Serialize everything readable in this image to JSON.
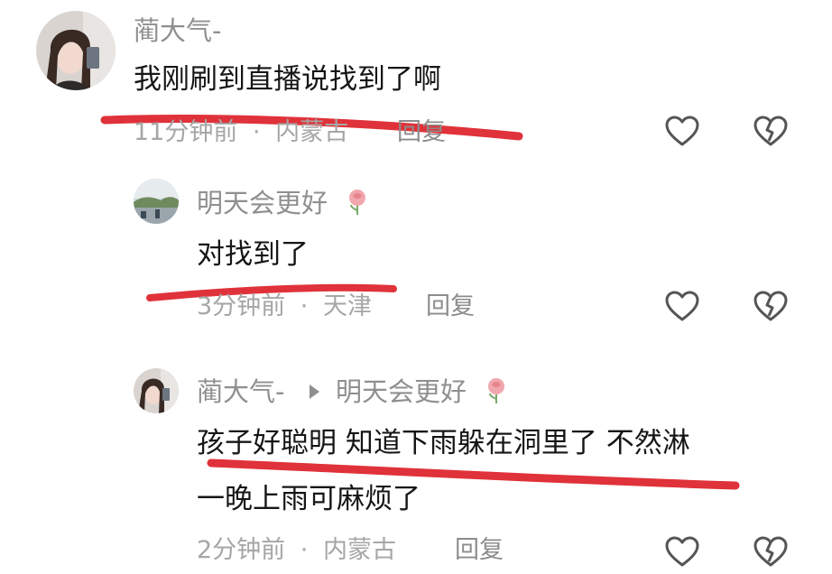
{
  "comments": [
    {
      "username": "蔺大气-",
      "text": "我刚刷到直播说找到了啊",
      "time": "11分钟前",
      "location": "内蒙古",
      "reply_label": "回复",
      "avatar": "woman-selfie"
    },
    {
      "username": "明天会更好",
      "badge_icon": "rose-icon",
      "text": "对找到了",
      "time": "3分钟前",
      "location": "天津",
      "reply_label": "回复",
      "avatar": "landscape"
    },
    {
      "username": "蔺大气-",
      "reply_to": "明天会更好",
      "badge_icon": "rose-icon",
      "text_line1": "孩子好聪明 知道下雨躲在洞里了 不然淋",
      "text_line2": "一晚上雨可麻烦了",
      "time": "2分钟前",
      "location": "内蒙古",
      "reply_label": "回复",
      "avatar": "woman-selfie"
    }
  ],
  "meta_separator": "·",
  "colors": {
    "underline": "#e0323a",
    "username": "#8f8f8f",
    "meta": "#a6a6a6"
  }
}
